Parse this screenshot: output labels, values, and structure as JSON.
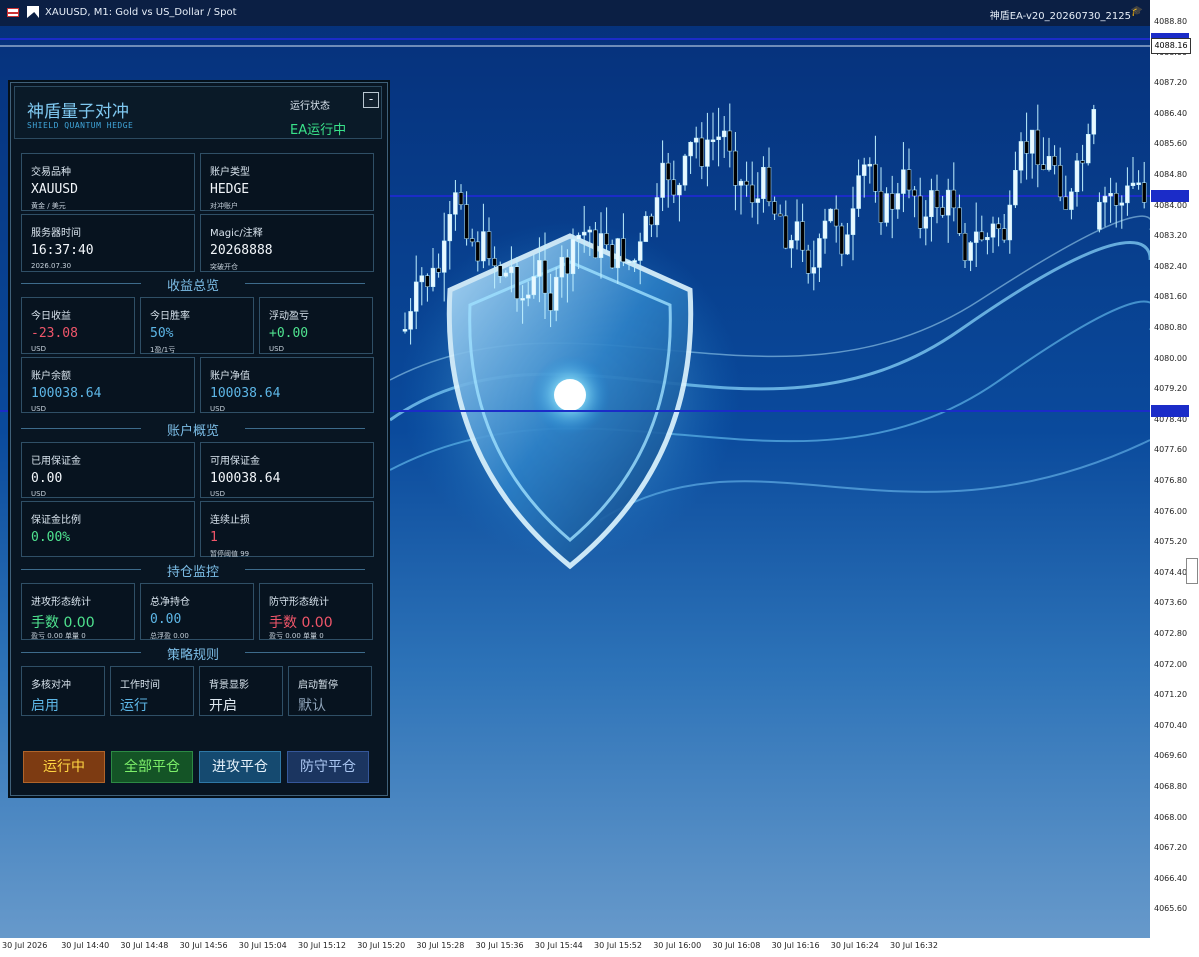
{
  "window": {
    "title": "XAUUSD, M1:  Gold vs US_Dollar / Spot",
    "ea_name": "神盾EA-v20_20260730_2125"
  },
  "colors": {
    "panel_bg": "#081522",
    "accent_blue": "#5db6e6",
    "status_green": "#39e28a",
    "loss_red": "#f0566a",
    "profit_green": "#4fe38f",
    "hline_blue": "#1b2cc8"
  },
  "icons": {
    "flag": "flag-icon",
    "chart_type": "chart-arrow-icon",
    "ea_hat": "graduation-cap-icon",
    "minimize": "minimize-icon"
  },
  "price_axis": {
    "labels": [
      "4088.80",
      "4088.00",
      "4087.20",
      "4086.40",
      "4085.60",
      "4084.80",
      "4084.00",
      "4083.20",
      "4082.40",
      "4081.60",
      "4080.80",
      "4080.00",
      "4079.20",
      "4078.40",
      "4077.60",
      "4076.80",
      "4076.00",
      "4075.20",
      "4074.40",
      "4073.60",
      "4072.80",
      "4072.00",
      "4071.20",
      "4070.40",
      "4069.60",
      "4068.80",
      "4068.00",
      "4067.20",
      "4066.40",
      "4065.60"
    ],
    "current_price": "4088.16"
  },
  "time_axis": {
    "labels": [
      "30 Jul 2026",
      "30 Jul 14:40",
      "30 Jul 14:48",
      "30 Jul 14:56",
      "30 Jul 15:04",
      "30 Jul 15:12",
      "30 Jul 15:20",
      "30 Jul 15:28",
      "30 Jul 15:36",
      "30 Jul 15:44",
      "30 Jul 15:52",
      "30 Jul 16:00",
      "30 Jul 16:08",
      "30 Jul 16:16",
      "30 Jul 16:24",
      "30 Jul 16:32"
    ]
  },
  "panel": {
    "title_cn": "神盾量子对冲",
    "title_en": "SHIELD QUANTUM HEDGE",
    "status_label": "运行状态",
    "status_value": "EA运行中",
    "minimize_label": "-",
    "symbol": {
      "label": "交易品种",
      "value": "XAUUSD",
      "sub": "黄金 / 美元"
    },
    "account_type": {
      "label": "账户类型",
      "value": "HEDGE",
      "sub": "对冲账户"
    },
    "server_time": {
      "label": "服务器时间",
      "value": "16:37:40",
      "sub": "2026.07.30"
    },
    "magic": {
      "label": "Magic/注释",
      "value": "20268888",
      "sub": "突破开仓"
    },
    "section_profit": "收益总览",
    "today_profit": {
      "label": "今日收益",
      "value": "-23.08",
      "sub": "USD"
    },
    "today_winrate": {
      "label": "今日胜率",
      "value": "50%",
      "sub": "1盈/1亏"
    },
    "floating_pl": {
      "label": "浮动盈亏",
      "value": "+0.00",
      "sub": "USD"
    },
    "balance": {
      "label": "账户余额",
      "value": "100038.64",
      "sub": "USD"
    },
    "equity": {
      "label": "账户净值",
      "value": "100038.64",
      "sub": "USD"
    },
    "section_account": "账户概览",
    "used_margin": {
      "label": "已用保证金",
      "value": "0.00",
      "sub": "USD"
    },
    "free_margin": {
      "label": "可用保证金",
      "value": "100038.64",
      "sub": "USD"
    },
    "margin_ratio": {
      "label": "保证金比例",
      "value": "0.00%"
    },
    "consec_stop": {
      "label": "连续止损",
      "value": "1",
      "sub": "暂停阈值 99"
    },
    "section_position": "持仓监控",
    "attack_stats": {
      "label": "进攻形态统计",
      "value": "手数  0.00",
      "sub": "盈亏 0.00 单量 0"
    },
    "net_position": {
      "label": "总净持仓",
      "value": "0.00",
      "sub": "总浮盈 0.00"
    },
    "defense_stats": {
      "label": "防守形态统计",
      "value": "手数  0.00",
      "sub": "盈亏 0.00 单量 0"
    },
    "section_strategy": "策略规则",
    "rule_multicore": {
      "label": "多核对冲",
      "value": "启用"
    },
    "rule_worktime": {
      "label": "工作时间",
      "value": "运行"
    },
    "rule_background": {
      "label": "背景显影",
      "value": "开启"
    },
    "rule_startpause": {
      "label": "启动暂停",
      "value": "默认"
    },
    "buttons": {
      "running": "运行中",
      "close_all": "全部平仓",
      "close_attack": "进攻平仓",
      "close_defense": "防守平仓"
    }
  }
}
